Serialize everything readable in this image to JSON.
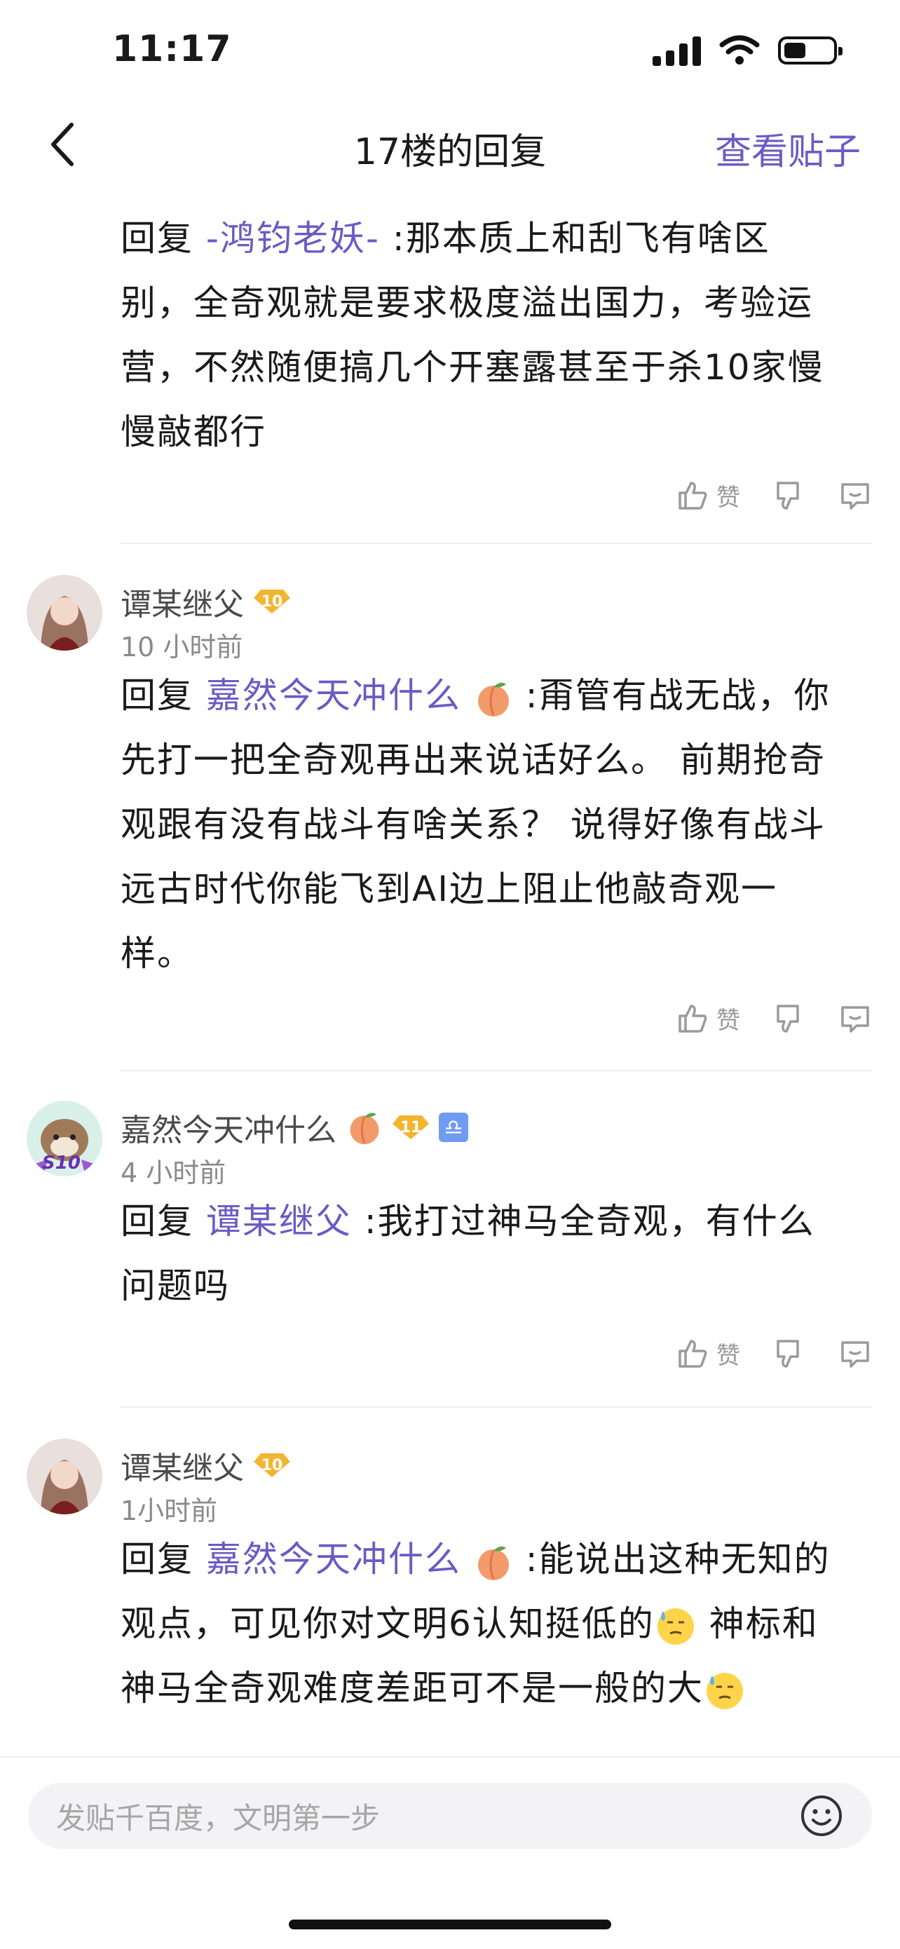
{
  "status_bar": {
    "time": "11:17"
  },
  "nav": {
    "title": "17楼的回复",
    "view_post": "查看贴子"
  },
  "comments": [
    {
      "reply_prefix": "回复",
      "mention": "-鸿钧老妖-",
      "text_lines": [
        ":那本质上和刮飞有啥区",
        "别，全奇观就是要求极度溢出国力，考验运",
        "营，不然随便搞几个开塞露甚至于杀10家慢",
        "慢敲都行"
      ],
      "like_label": "赞"
    },
    {
      "username": "谭某继父",
      "level": "10",
      "time": "10 小时前",
      "reply_prefix": "回复",
      "mention": "嘉然今天冲什么",
      "text_lines": [
        ":甭管有战无战，你",
        "先打一把全奇观再出来说话好么。 前期抢奇",
        "观跟有没有战斗有啥关系？ 说得好像有战斗",
        "远古时代你能飞到AI边上阻止他敲奇观一",
        "样。"
      ],
      "like_label": "赞"
    },
    {
      "username": "嘉然今天冲什么",
      "level": "11",
      "zodiac": "♎",
      "avatar_badge": "S10",
      "time": "4 小时前",
      "reply_prefix": "回复",
      "mention": "谭某继父",
      "text_lines": [
        ":我打过神马全奇观，有什么",
        "问题吗"
      ],
      "like_label": "赞"
    },
    {
      "username": "谭某继父",
      "level": "10",
      "time": "1小时前",
      "reply_prefix": "回复",
      "mention": "嘉然今天冲什么",
      "text_lines": [
        ":能说出这种无知的",
        "观点，可见你对文明6认知挺低的",
        " 神标和",
        "神马全奇观难度差距可不是一般的大"
      ]
    }
  ],
  "input": {
    "placeholder": "发贴千百度，文明第一步"
  },
  "colors": {
    "accent": "#6a5bc4",
    "level_badge": "#f2b530"
  }
}
